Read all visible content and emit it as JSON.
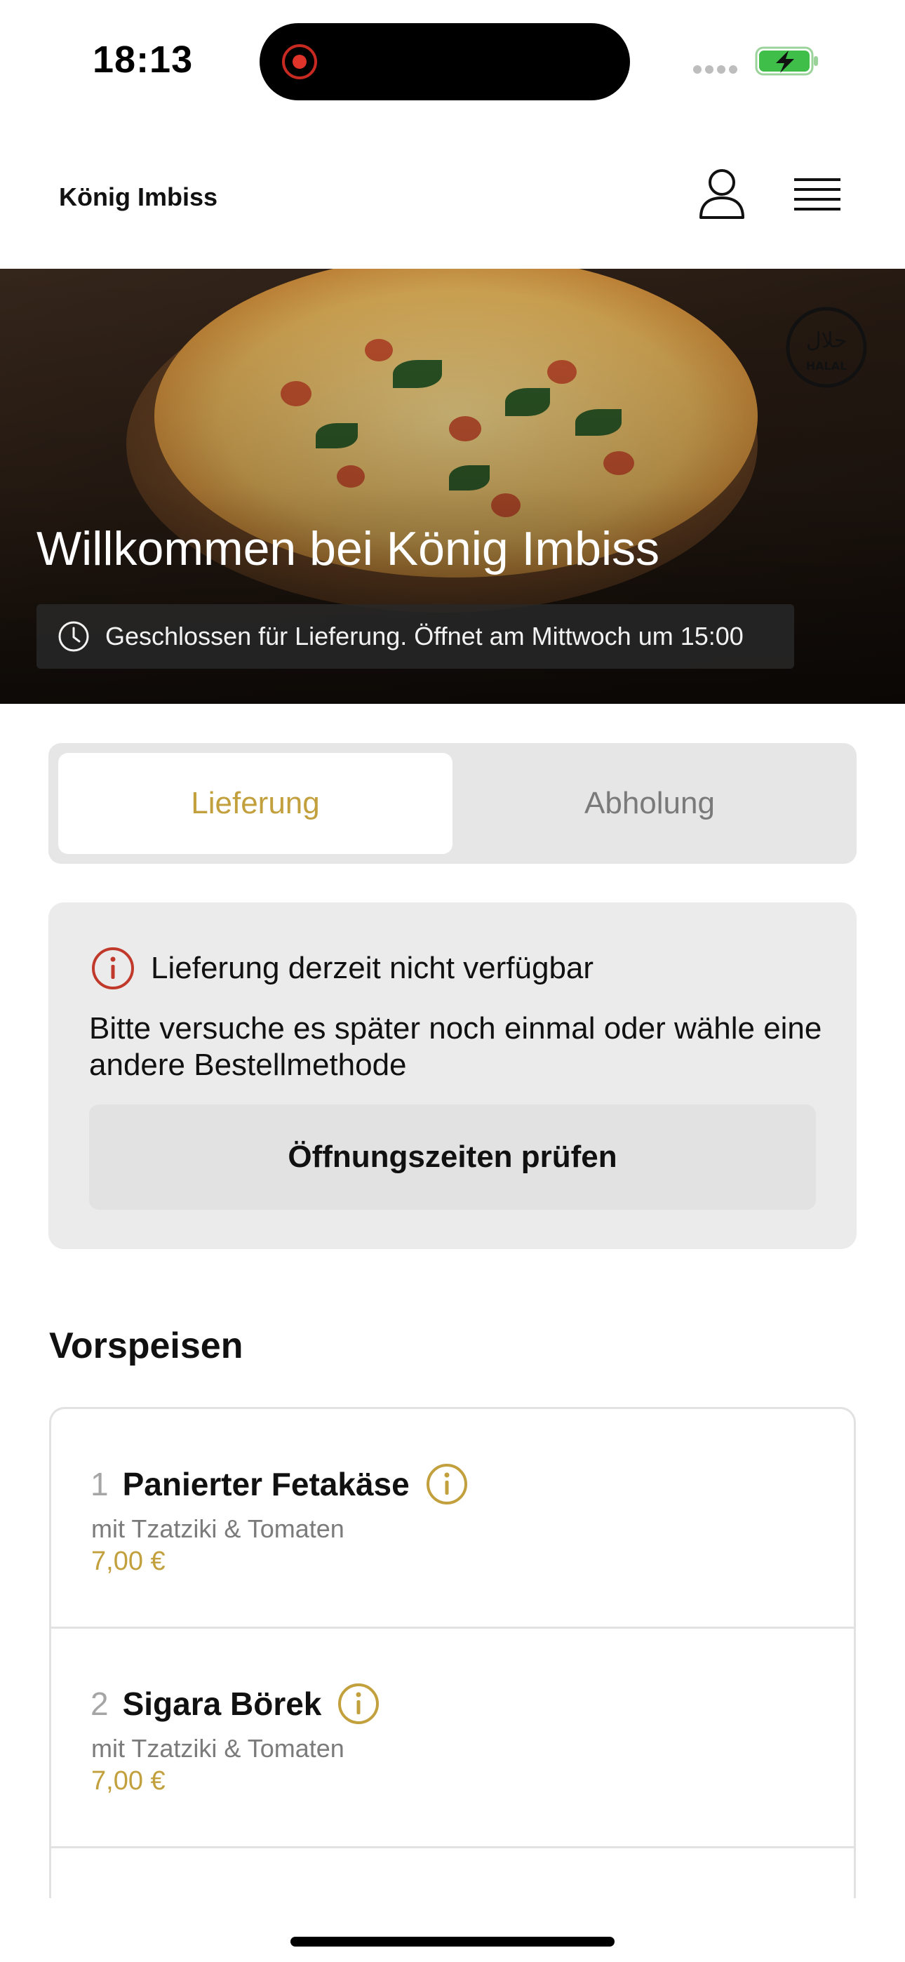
{
  "status_bar": {
    "time": "18:13"
  },
  "header": {
    "brand": "König Imbiss"
  },
  "hero": {
    "title": "Willkommen bei König Imbiss",
    "status": "Geschlossen für Lieferung. Öffnet am Mittwoch um 15:00",
    "badge_text": "HALAL",
    "badge_arabic": "حلال"
  },
  "tabs": [
    {
      "label": "Lieferung",
      "active": true
    },
    {
      "label": "Abholung",
      "active": false
    }
  ],
  "notice": {
    "title": "Lieferung derzeit nicht verfügbar",
    "text": "Bitte versuche es später noch einmal oder wähle eine andere Bestellmethode",
    "button": "Öffnungszeiten prüfen"
  },
  "section": {
    "title": "Vorspeisen",
    "items": [
      {
        "number": "1",
        "name": "Panierter Fetakäse",
        "desc": "mit Tzatziki & Tomaten",
        "price": "7,00 €"
      },
      {
        "number": "2",
        "name": "Sigara Börek",
        "desc": "mit Tzatziki & Tomaten",
        "price": "7,00 €"
      }
    ]
  },
  "colors": {
    "accent": "#c2a03d",
    "alert": "#c0392b"
  }
}
